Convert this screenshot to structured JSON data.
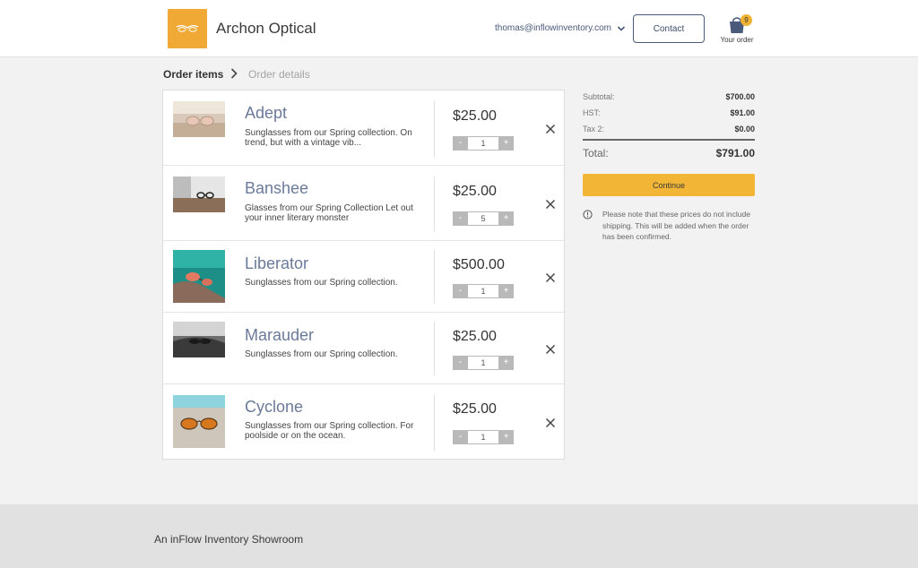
{
  "header": {
    "brand": "Archon Optical",
    "account_email": "thomas@inflowinventory.com",
    "contact_label": "Contact",
    "cart_count": "9",
    "cart_label": "Your order"
  },
  "breadcrumb": {
    "step1": "Order items",
    "step2": "Order details"
  },
  "items": [
    {
      "name": "Adept",
      "description": "Sunglasses from our Spring collection. On trend, but with a vintage vib...",
      "price": "$25.00",
      "quantity": "1"
    },
    {
      "name": "Banshee",
      "description": "Glasses from our Spring Collection Let out your inner literary monster",
      "price": "$25.00",
      "quantity": "5"
    },
    {
      "name": "Liberator",
      "description": "Sunglasses from our Spring collection.",
      "price": "$500.00",
      "quantity": "1"
    },
    {
      "name": "Marauder",
      "description": "Sunglasses from our Spring collection.",
      "price": "$25.00",
      "quantity": "1"
    },
    {
      "name": "Cyclone",
      "description": "Sunglasses from our Spring collection.  For poolside or on the ocean.",
      "price": "$25.00",
      "quantity": "1"
    }
  ],
  "stepper": {
    "minus": "-",
    "plus": "+"
  },
  "summary": {
    "subtotal_label": "Subtotal:",
    "subtotal_value": "$700.00",
    "hst_label": "HST:",
    "hst_value": "$91.00",
    "tax2_label": "Tax 2:",
    "tax2_value": "$0.00",
    "total_label": "Total:",
    "total_value": "$791.00",
    "continue_label": "Continue",
    "note": "Please note that these prices do not include shipping. This will be added when the order has been confirmed."
  },
  "footer": {
    "text": "An inFlow Inventory Showroom"
  },
  "colors": {
    "accent": "#f2b535",
    "name_text": "#6b7a99",
    "footer_bg": "#e1e1e1"
  },
  "icons": [
    "chevron-down-icon",
    "shopping-bag-icon",
    "chevron-right-icon",
    "close-icon",
    "info-icon"
  ]
}
